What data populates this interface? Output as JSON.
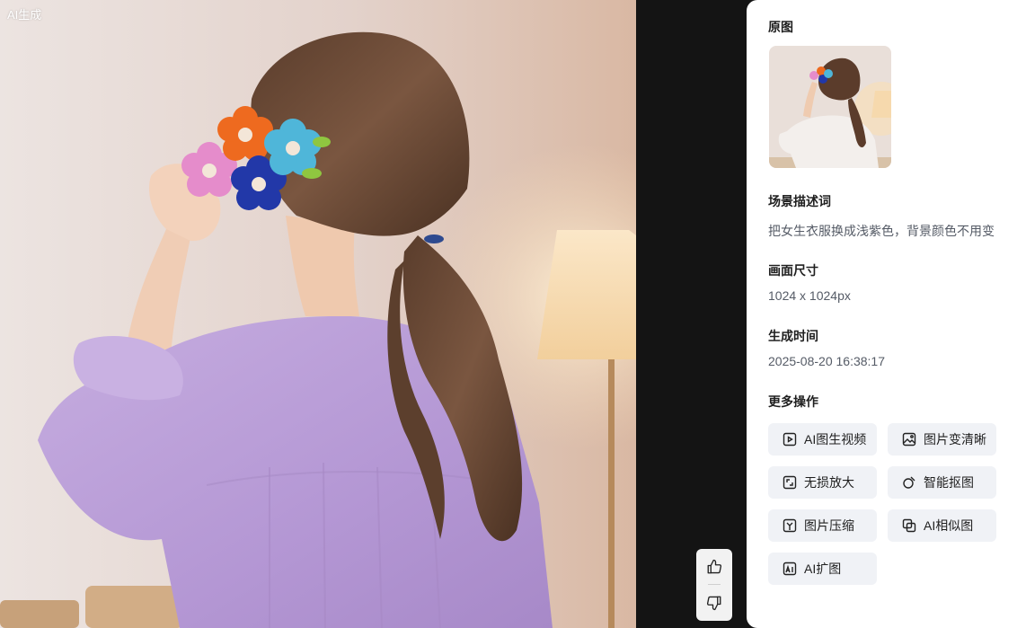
{
  "viewer": {
    "ai_tag": "AI生成"
  },
  "panel": {
    "original": {
      "title": "原图"
    },
    "scene": {
      "title": "场景描述词",
      "value": "把女生衣服换成浅紫色，背景颜色不用变"
    },
    "size": {
      "title": "画面尺寸",
      "value": "1024 x 1024px"
    },
    "time": {
      "title": "生成时间",
      "value": "2025-08-20 16:38:17"
    },
    "more": {
      "title": "更多操作",
      "actions": [
        {
          "label": "AI图生视频",
          "icon": "image-to-video-icon"
        },
        {
          "label": "图片变清晰",
          "icon": "enhance-image-icon"
        },
        {
          "label": "无损放大",
          "icon": "upscale-icon"
        },
        {
          "label": "智能抠图",
          "icon": "cutout-icon"
        },
        {
          "label": "图片压缩",
          "icon": "compress-icon"
        },
        {
          "label": "AI相似图",
          "icon": "similar-image-icon"
        },
        {
          "label": "AI扩图",
          "icon": "expand-image-icon"
        }
      ]
    }
  },
  "feedback": {
    "like_icon": "thumbs-up-icon",
    "dislike_icon": "thumbs-down-icon"
  },
  "colors": {
    "panel_bg": "#ffffff",
    "viewer_bg": "#141414",
    "button_bg": "#f0f2f6",
    "dress": "#b89bd6"
  }
}
